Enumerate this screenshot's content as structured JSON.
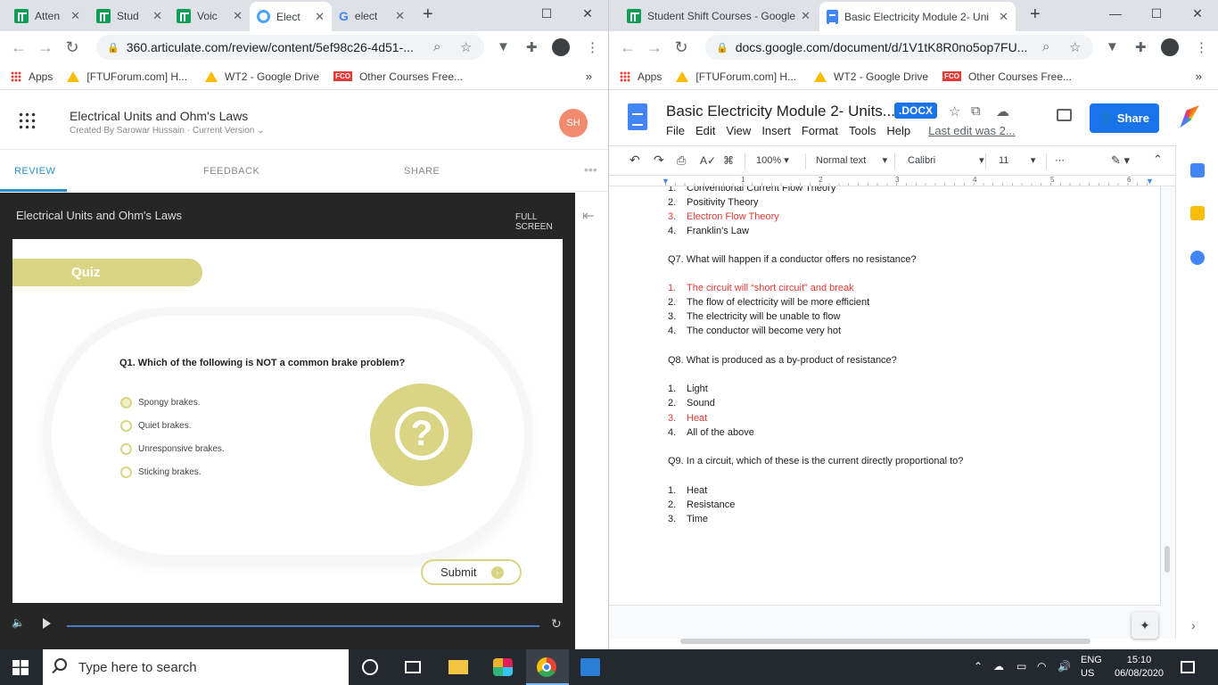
{
  "left_window": {
    "tabs": [
      {
        "title": "Atten",
        "icon": "sheets-icon"
      },
      {
        "title": "Stud",
        "icon": "sheets-icon"
      },
      {
        "title": "Voic",
        "icon": "sheets-icon"
      },
      {
        "title": "Elect",
        "icon": "articulate-icon",
        "active": true
      },
      {
        "title": "elect",
        "icon": "google-icon"
      }
    ],
    "url": "360.articulate.com/review/content/5ef98c26-4d51-...",
    "bookmarks": [
      "Apps",
      "[FTUForum.com] H...",
      "WT2 - Google Drive",
      "Other Courses Free..."
    ],
    "bookmarks_more": "»"
  },
  "articulate": {
    "title": "Electrical Units and Ohm's Laws",
    "created_by": "Created By Sarowar Hussain",
    "version": "Current Version ⌄",
    "avatar": "SH",
    "tabs": [
      "REVIEW",
      "FEEDBACK",
      "SHARE"
    ],
    "more": "•••",
    "player": {
      "title": "Electrical Units and Ohm's Laws",
      "fullscreen": "FULL SCREEN",
      "quiz_label": "Quiz",
      "question": "Q1. Which of the following is NOT a common brake problem?",
      "options": [
        "Spongy brakes.",
        "Quiet brakes.",
        "Unresponsive brakes.",
        "Sticking brakes."
      ],
      "submit": "Submit"
    },
    "accent": "#d9d584"
  },
  "right_window": {
    "tabs": [
      {
        "title": "Student Shift Courses - Google",
        "icon": "sheets-icon"
      },
      {
        "title": "Basic Electricity Module 2- Uni",
        "icon": "docs-icon",
        "active": true
      }
    ],
    "url": "docs.google.com/document/d/1V1tK8R0no5op7FU...",
    "bookmarks": [
      "Apps",
      "[FTUForum.com] H...",
      "WT2 - Google Drive",
      "Other Courses Free..."
    ],
    "bookmarks_more": "»"
  },
  "docs": {
    "title": "Basic Electricity Module 2- Units...",
    "badge": ".DOCX",
    "menu": [
      "File",
      "Edit",
      "View",
      "Insert",
      "Format",
      "Tools",
      "Help"
    ],
    "last_edit": "Last edit was 2...",
    "share": "Share",
    "toolbar": {
      "zoom": "100%",
      "style": "Normal text",
      "font": "Calibri",
      "size": "11"
    },
    "ruler": [
      "1",
      "2",
      "3",
      "4",
      "5",
      "6"
    ],
    "lines": [
      {
        "num": "1.",
        "text": "Conventional Current Flow Theory",
        "red": false
      },
      {
        "num": "2.",
        "text": "Positivity Theory",
        "red": false
      },
      {
        "num": "3.",
        "text": "Electron Flow Theory",
        "red": true
      },
      {
        "num": "4.",
        "text": "Franklin's Law",
        "red": false
      },
      {
        "num": "",
        "text": "Q7. What will happen if a conductor offers no resistance?",
        "red": false
      },
      {
        "num": "1.",
        "text": "The circuit will “short circuit” and break",
        "red": true
      },
      {
        "num": "2.",
        "text": "The flow of electricity will be more efficient",
        "red": false
      },
      {
        "num": "3.",
        "text": "The electricity will be unable to flow",
        "red": false
      },
      {
        "num": "4.",
        "text": "The conductor will become very hot",
        "red": false
      },
      {
        "num": "",
        "text": "Q8. What is produced as a by-product of resistance?",
        "red": false
      },
      {
        "num": "1.",
        "text": "Light",
        "red": false
      },
      {
        "num": "2.",
        "text": "Sound",
        "red": false
      },
      {
        "num": "3.",
        "text": "Heat",
        "red": true
      },
      {
        "num": "4.",
        "text": "All of the above",
        "red": false
      },
      {
        "num": "",
        "text": "Q9. In a circuit, which of these is the current directly proportional to?",
        "red": false
      },
      {
        "num": "1.",
        "text": "Heat",
        "red": false
      },
      {
        "num": "2.",
        "text": "Resistance",
        "red": false
      },
      {
        "num": "3.",
        "text": "Time",
        "red": false
      }
    ],
    "answer_color": "#e53935"
  },
  "taskbar": {
    "search_placeholder": "Type here to search",
    "lang": "ENG",
    "region": "US",
    "time": "15:10",
    "date": "06/08/2020"
  }
}
